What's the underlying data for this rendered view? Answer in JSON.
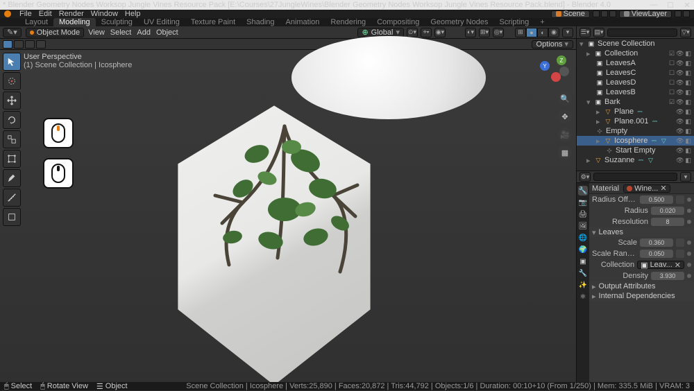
{
  "title": "* Blender Geometry Nodes Worksop Jungle Vines Resource Pack [E:\\Courses\\27JungleWines\\Blender Geometry Nodes Worksop Jungle Vines Resource Pack.blend] - Blender 4.0",
  "menubar": [
    "File",
    "Edit",
    "Render",
    "Window",
    "Help"
  ],
  "scene_label": "Scene",
  "viewlayer_label": "ViewLayer",
  "workspaces": {
    "items": [
      "Layout",
      "Modeling",
      "Sculpting",
      "UV Editing",
      "Texture Paint",
      "Shading",
      "Animation",
      "Rendering",
      "Compositing",
      "Geometry Nodes",
      "Scripting",
      "+"
    ],
    "active": 1
  },
  "view3d": {
    "mode": "Object Mode",
    "menus": [
      "View",
      "Select",
      "Add",
      "Object"
    ],
    "orientation": "Global",
    "options_label": "Options",
    "info1": "User Perspective",
    "info2": "(1) Scene Collection | Icosphere"
  },
  "outliner": {
    "root": "Scene Collection",
    "coll": "Collection",
    "leaves": [
      "LeavesA",
      "LeavesC",
      "LeavesD",
      "LeavesB"
    ],
    "bark": "Bark",
    "bark_children": [
      "Plane",
      "Plane.001",
      "Empty",
      "Icosphere",
      "Start Empty"
    ],
    "bark_selected_index": 3,
    "suzanne": "Suzanne"
  },
  "props": {
    "header_label": "Material",
    "header_chip": "Wine...",
    "rows": [
      {
        "label": "Radius Offs...",
        "val": "0.500",
        "extra": true
      },
      {
        "label": "Radius",
        "val": "0.020"
      },
      {
        "label": "Resolution",
        "val": "8"
      }
    ],
    "panel": "Leaves",
    "rows2": [
      {
        "label": "Scale",
        "val": "0.360",
        "extra": true
      },
      {
        "label": "Scale Rand...",
        "val": "0.050",
        "extra": true
      },
      {
        "label": "Collection",
        "chip": "Leav...",
        "x": true
      },
      {
        "label": "Density",
        "val": "3.930"
      }
    ],
    "foot": [
      "Output Attributes",
      "Internal Dependencies"
    ]
  },
  "statusbar": {
    "left": [
      {
        "icon": "⦿",
        "text": "Select"
      },
      {
        "icon": "⦿",
        "text": "Rotate View"
      },
      {
        "icon": "⦿",
        "text": "Object"
      }
    ],
    "right": "Scene Collection | Icosphere | Verts:25,890 | Faces:20,872 | Tris:44,792 | Objects:1/6 | Duration: 00:10+10 (From 1/250) | Mem: 335.5 MiB | VRAM: 3"
  }
}
